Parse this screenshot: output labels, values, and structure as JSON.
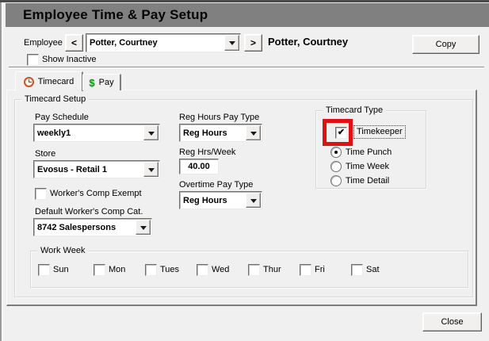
{
  "window": {
    "title": "Employee Time & Pay Setup"
  },
  "header": {
    "employee_label": "Employee",
    "prev_button": "<",
    "next_button": ">",
    "employee_value": "Potter, Courtney",
    "employee_display": "Potter, Courtney",
    "copy_button": "Copy",
    "show_inactive": {
      "label": "Show Inactive",
      "checked": false
    }
  },
  "tabs": [
    {
      "label": "Timecard",
      "icon": "clock-icon",
      "active": true
    },
    {
      "label": "Pay",
      "icon": "dollar-icon",
      "active": false
    }
  ],
  "timecard_setup": {
    "group_label": "Timecard Setup",
    "pay_schedule": {
      "label": "Pay Schedule",
      "value": "weekly1"
    },
    "store": {
      "label": "Store",
      "value": "Evosus - Retail 1"
    },
    "workers_comp_exempt": {
      "label": "Worker's Comp Exempt",
      "checked": false
    },
    "default_workers_comp": {
      "label": "Default Worker's Comp Cat.",
      "value": "8742 Salespersons"
    },
    "reg_hours_pay_type": {
      "label": "Reg Hours Pay Type",
      "value": "Reg Hours"
    },
    "reg_hrs_week": {
      "label": "Reg Hrs/Week",
      "value": "40.00"
    },
    "overtime_pay_type": {
      "label": "Overtime Pay Type",
      "value": "Reg Hours"
    }
  },
  "timecard_type": {
    "group_label": "Timecard Type",
    "timekeeper": {
      "label": "Timekeeper",
      "checked": true,
      "highlighted": true
    },
    "options": [
      {
        "label": "Time Punch",
        "selected": true
      },
      {
        "label": "Time Week",
        "selected": false
      },
      {
        "label": "Time Detail",
        "selected": false
      }
    ]
  },
  "work_week": {
    "group_label": "Work Week",
    "days": [
      {
        "label": "Sun",
        "checked": false
      },
      {
        "label": "Mon",
        "checked": false
      },
      {
        "label": "Tues",
        "checked": false
      },
      {
        "label": "Wed",
        "checked": false
      },
      {
        "label": "Thur",
        "checked": false
      },
      {
        "label": "Fri",
        "checked": false
      },
      {
        "label": "Sat",
        "checked": false
      }
    ]
  },
  "footer": {
    "close_button": "Close"
  },
  "colors": {
    "titlebar": "#808080",
    "highlight_red": "#e01010",
    "clock_icon_orange": "#c6552e",
    "dollar_icon_green": "#16a016"
  }
}
